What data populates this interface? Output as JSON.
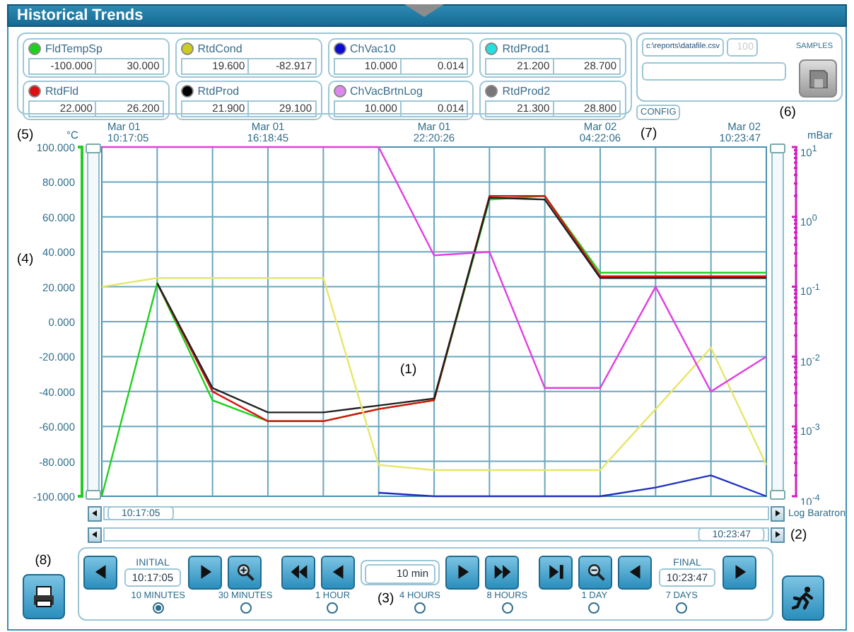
{
  "window": {
    "title": "Historical Trends"
  },
  "channels": [
    {
      "name": "FldTempSp",
      "color": "#1fd11f",
      "min": "-100.000",
      "max": "30.000"
    },
    {
      "name": "RtdCond",
      "color": "#cccc22",
      "min": "19.600",
      "max": "-82.917"
    },
    {
      "name": "ChVac10",
      "color": "#0a0ad0",
      "min": "10.000",
      "max": "0.014"
    },
    {
      "name": "RtdProd1",
      "color": "#22e0e0",
      "min": "21.200",
      "max": "28.700"
    },
    {
      "name": "RtdFld",
      "color": "#dd1111",
      "min": "22.000",
      "max": "26.200"
    },
    {
      "name": "RtdProd",
      "color": "#000000",
      "min": "21.900",
      "max": "29.100"
    },
    {
      "name": "ChVacBrtnLog",
      "color": "#dd88ee",
      "min": "10.000",
      "max": "0.014"
    },
    {
      "name": "RtdProd2",
      "color": "#777777",
      "min": "21.300",
      "max": "28.800"
    }
  ],
  "export": {
    "file": "c:\\reports\\datafile.csv",
    "samples": "100",
    "samples_disabled": true,
    "samples_label": "SAMPLES",
    "config": "CONFIG",
    "callout": "(6)"
  },
  "chart": {
    "callouts": [
      "(5)",
      "(7)",
      "(4)",
      "(1)"
    ],
    "chart_data": {
      "type": "line",
      "grid": true,
      "ylabel": "°C",
      "categories": [
        "Mar 01\n10:17:05",
        null,
        null,
        "Mar 01\n16:18:45",
        null,
        null,
        "Mar 01\n22:20:26",
        null,
        null,
        "Mar 02\n04:22:06",
        null,
        null,
        "Mar 02\n10:23:47"
      ],
      "ylim": [
        -100,
        100
      ],
      "yticks": [
        {
          "value": 100,
          "label": "100.000"
        },
        {
          "value": 80,
          "label": "80.000"
        },
        {
          "value": 60,
          "label": "60.000"
        },
        {
          "value": 40,
          "label": "40.000"
        },
        {
          "value": 20,
          "label": "20.000"
        },
        {
          "value": 0,
          "label": "0.000"
        },
        {
          "value": -20,
          "label": "-20.000"
        },
        {
          "value": -40,
          "label": "-40.000"
        },
        {
          "value": -60,
          "label": "-60.000"
        },
        {
          "value": -80,
          "label": "-80.000"
        },
        {
          "value": -100,
          "label": "-100.000"
        }
      ],
      "series": [
        {
          "color": "#1fd11f",
          "values": [
            -100,
            22,
            -45,
            -57,
            -57,
            -50,
            -45,
            70,
            72,
            28,
            28,
            28,
            28
          ]
        },
        {
          "color": "#dd1111",
          "values": [
            null,
            22,
            -40,
            -57,
            -57,
            -50,
            -45,
            72,
            72,
            26,
            26,
            26,
            26
          ]
        },
        {
          "color": "#202020",
          "values": [
            null,
            22,
            -38,
            -52,
            -52,
            -48,
            -44,
            71,
            70,
            25,
            25,
            25,
            25
          ]
        },
        {
          "color": "#e6e66a",
          "values": [
            20,
            25,
            25,
            25,
            25,
            -82,
            -85,
            -85,
            -85,
            -85,
            -50,
            -15,
            -82
          ]
        },
        {
          "color": "#2030c0",
          "values": [
            null,
            null,
            null,
            null,
            null,
            -98,
            -100,
            -100,
            -100,
            -100,
            -95,
            -88,
            -100
          ]
        },
        {
          "color": "#e040e0",
          "values": [
            100,
            100,
            100,
            100,
            100,
            100,
            38,
            40,
            -38,
            -38,
            20,
            -40,
            -20
          ]
        }
      ]
    },
    "right_axis": {
      "label": "mBar",
      "ticks": [
        "10$^{1}$",
        "10$^{0}$",
        "10$^{-1}$",
        "10$^{-2}$",
        "10$^{-3}$",
        "10$^{-4}$"
      ],
      "sensor": "Log Baratron"
    }
  },
  "scrollbars": [
    {
      "time": "10:17:05",
      "level": 0
    },
    {
      "time": "10:23:47",
      "level": 1,
      "callout": "(2)"
    }
  ],
  "navigation": {
    "print_callout": "(8)",
    "initial": {
      "label": "INITIAL",
      "value": "10:17:05"
    },
    "span": "10 min",
    "final": {
      "label": "FINAL",
      "value": "10:23:47"
    },
    "callout": "(3)",
    "ranges": [
      {
        "label": "10 MINUTES",
        "selected": true
      },
      {
        "label": "30 MINUTES",
        "selected": false
      },
      {
        "label": "1 HOUR",
        "selected": false
      },
      {
        "label": "4 HOURS",
        "selected": false
      },
      {
        "label": "8 HOURS",
        "selected": false
      },
      {
        "label": "1 DAY",
        "selected": false
      },
      {
        "label": "7 DAYS",
        "selected": false
      }
    ]
  }
}
